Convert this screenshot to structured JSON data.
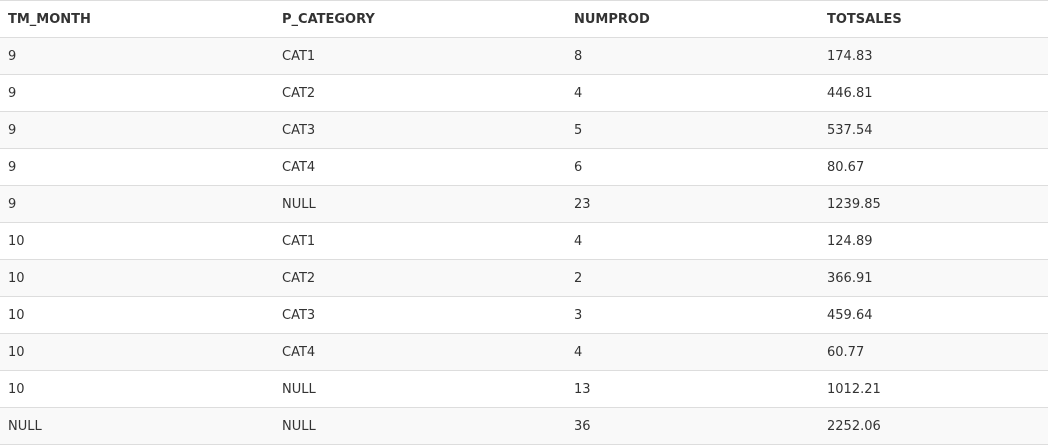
{
  "table": {
    "columns": [
      "TM_MONTH",
      "P_CATEGORY",
      "NUMPROD",
      "TOTSALES"
    ],
    "rows": [
      [
        "9",
        "CAT1",
        "8",
        "174.83"
      ],
      [
        "9",
        "CAT2",
        "4",
        "446.81"
      ],
      [
        "9",
        "CAT3",
        "5",
        "537.54"
      ],
      [
        "9",
        "CAT4",
        "6",
        "80.67"
      ],
      [
        "9",
        "NULL",
        "23",
        "1239.85"
      ],
      [
        "10",
        "CAT1",
        "4",
        "124.89"
      ],
      [
        "10",
        "CAT2",
        "2",
        "366.91"
      ],
      [
        "10",
        "CAT3",
        "3",
        "459.64"
      ],
      [
        "10",
        "CAT4",
        "4",
        "60.77"
      ],
      [
        "10",
        "NULL",
        "13",
        "1012.21"
      ],
      [
        "NULL",
        "NULL",
        "36",
        "2252.06"
      ]
    ]
  },
  "colors": {
    "text": "#333333",
    "row_stripe": "#f9f9f9",
    "border": "#dddddd"
  }
}
